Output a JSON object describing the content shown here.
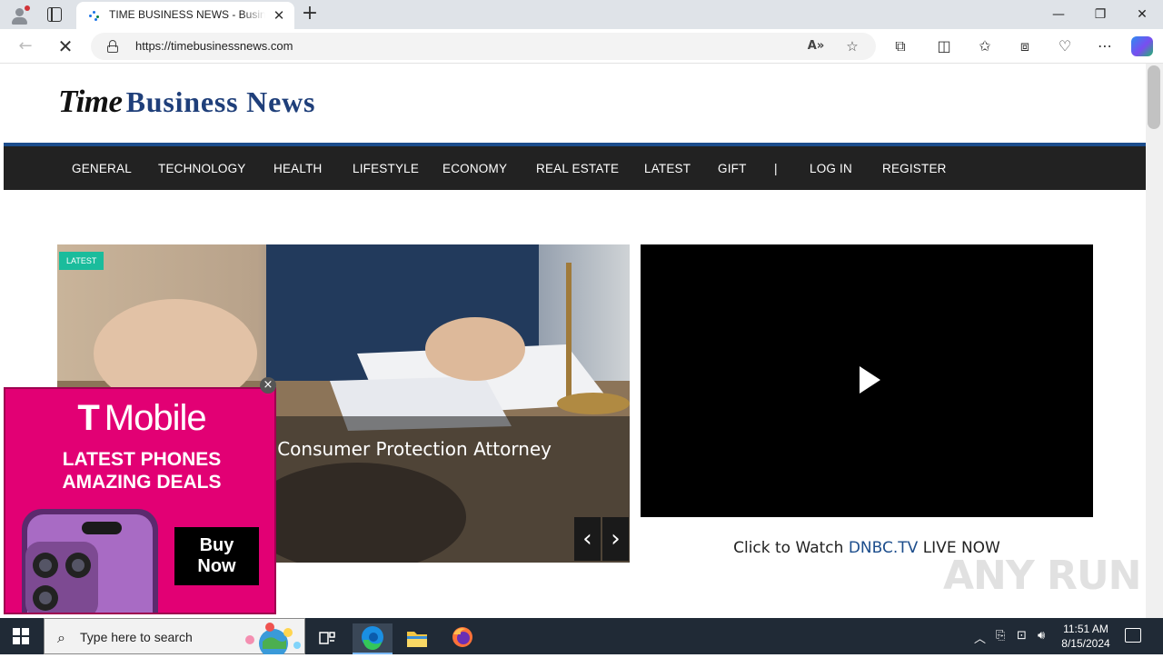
{
  "browser": {
    "tab_title": "TIME BUSINESS NEWS - Business News",
    "tab_close": "✕",
    "new_tab": "+",
    "url": "https://timebusinessnews.com",
    "window_controls": {
      "minimize": "—",
      "restore": "❐",
      "close": "✕"
    },
    "nav": {
      "back": "←",
      "stop": "✕"
    }
  },
  "site": {
    "logo_word_1": "Time",
    "logo_word_2": "Business News",
    "nav_items": [
      "GENERAL",
      "TECHNOLOGY",
      "HEALTH",
      "LIFESTYLE",
      "ECONOMY",
      "REAL ESTATE",
      "LATEST",
      "GIFT",
      "|",
      "LOG IN",
      "REGISTER"
    ],
    "slider": {
      "badge": "LATEST",
      "title": "t Consumer Protection Attorney",
      "prev": "‹",
      "next": "›"
    },
    "video_caption": {
      "before": "Click to Watch ",
      "link": "DNBC.TV",
      "after": " LIVE NOW"
    }
  },
  "ad": {
    "brand_mark": "T",
    "brand_name": "Mobile",
    "line_1": "LATEST PHONES",
    "line_2": "AMAZING DEALS",
    "cta_1": "Buy",
    "cta_2": "Now",
    "close": "×"
  },
  "watermark": "ANY RUN",
  "taskbar": {
    "search_placeholder": "Type here to search",
    "time": "11:51 AM",
    "date": "8/15/2024"
  },
  "colors": {
    "nav_bg": "#222222",
    "nav_accent": "#1c4d8c",
    "badge": "#1abc9c",
    "ad_magenta": "#e20074",
    "logo_blue": "#1f3f7a"
  }
}
